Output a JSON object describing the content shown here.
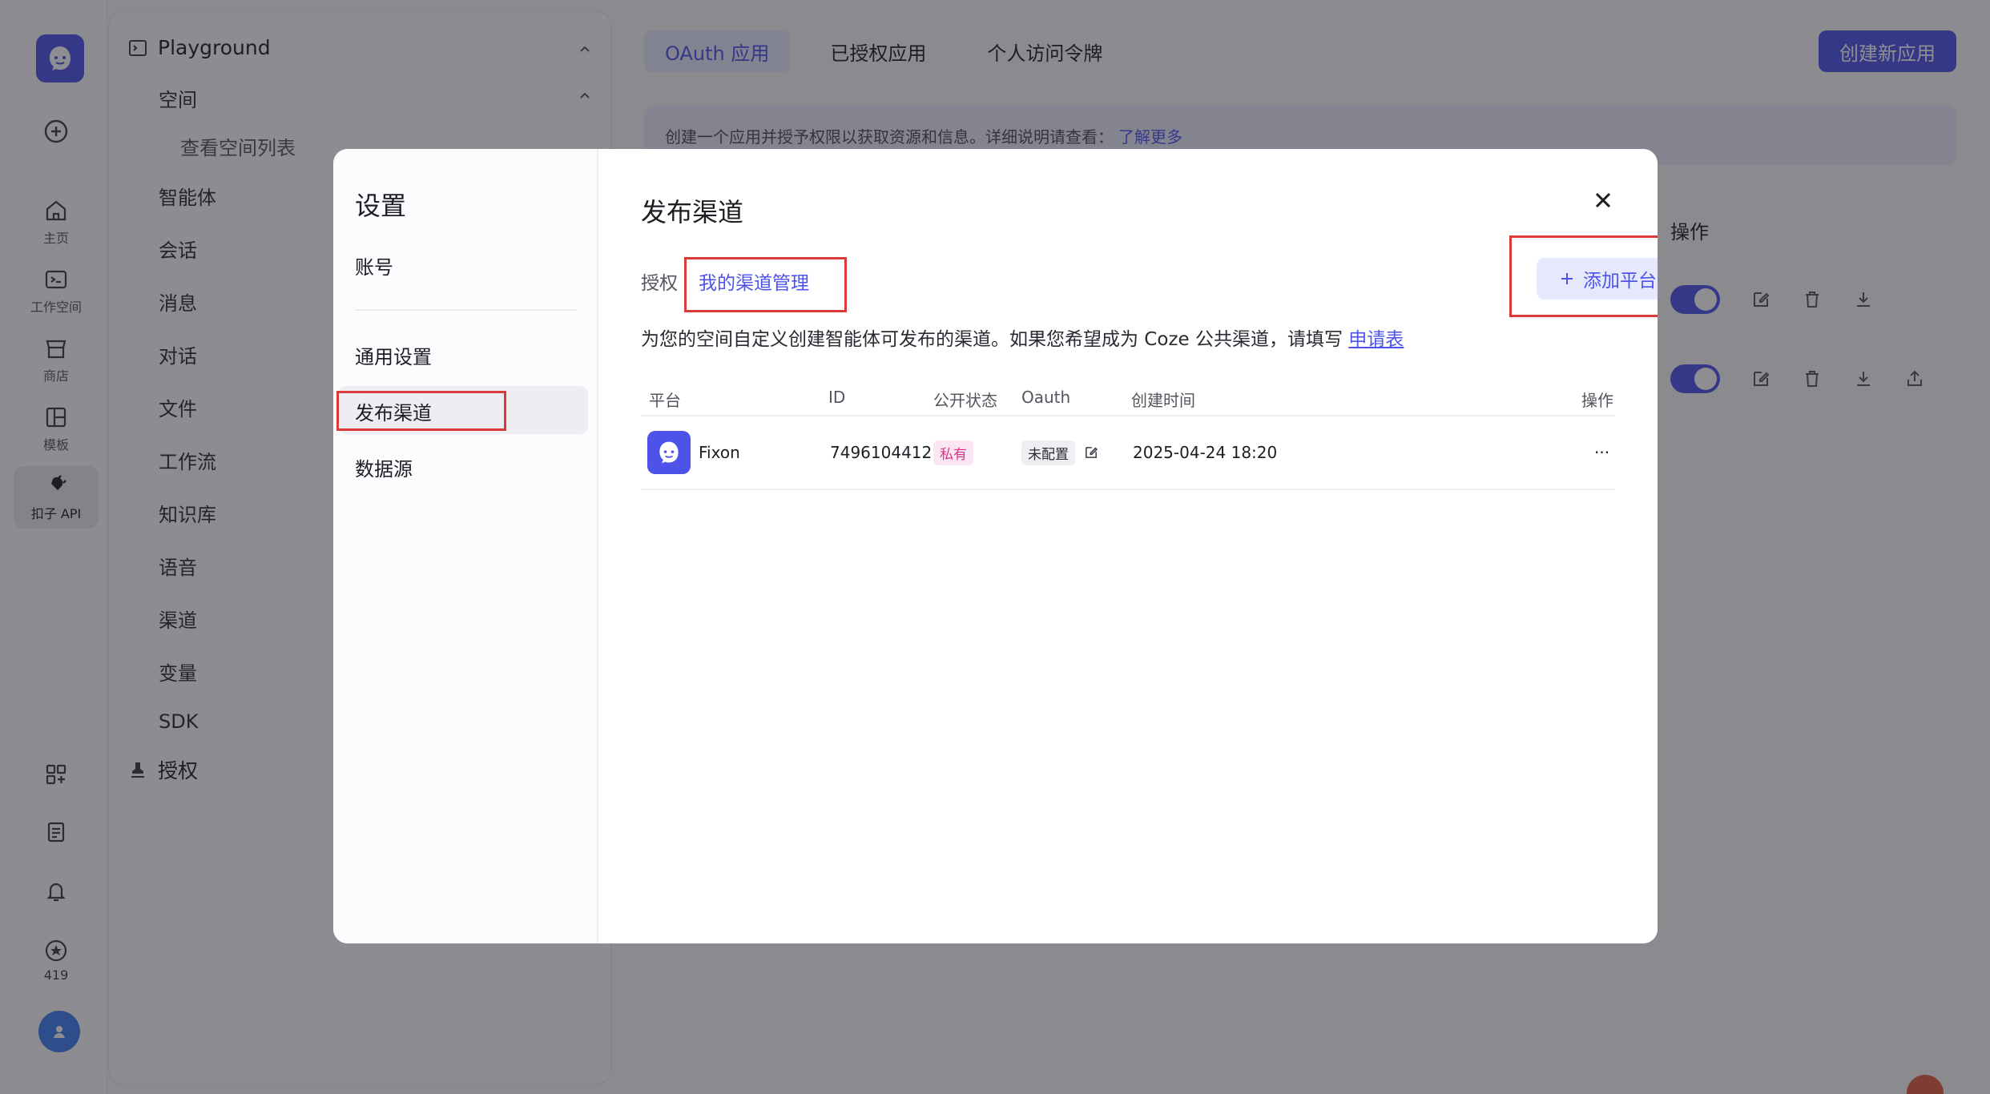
{
  "rail": {
    "items": [
      {
        "icon": "home-icon",
        "label": "主页"
      },
      {
        "icon": "workspace-icon",
        "label": "工作空间"
      },
      {
        "icon": "store-icon",
        "label": "商店"
      },
      {
        "icon": "template-icon",
        "label": "模板"
      },
      {
        "icon": "api-plug-icon",
        "label": "扣子 API"
      }
    ],
    "count_label": "419"
  },
  "nav": {
    "playground": "Playground",
    "space": "空间",
    "space_list": "查看空间列表",
    "items": [
      "智能体",
      "会话",
      "消息",
      "对话",
      "文件",
      "工作流",
      "知识库",
      "语音",
      "渠道",
      "变量",
      "SDK"
    ],
    "auth": "授权"
  },
  "main": {
    "tabs": [
      "OAuth 应用",
      "已授权应用",
      "个人访问令牌"
    ],
    "create_button": "创建新应用",
    "banner_text": "创建一个应用并授予权限以获取资源和信息。详细说明请查看：",
    "banner_link": "了解更多",
    "ops_header": "操作"
  },
  "modal": {
    "title": "设置",
    "nav": {
      "account": "账号",
      "general": "通用设置",
      "publish": "发布渠道",
      "datasource": "数据源"
    },
    "panel_title": "发布渠道",
    "subtabs": {
      "auth": "授权",
      "manage": "我的渠道管理"
    },
    "add_button": "添加平台",
    "description": "为您的空间自定义创建智能体可发布的渠道。如果您希望成为 Coze 公共渠道，请填写",
    "description_link": "申请表",
    "table": {
      "headers": {
        "platform": "平台",
        "id": "ID",
        "status": "公开状态",
        "oauth": "Oauth",
        "created": "创建时间",
        "ops": "操作"
      },
      "rows": [
        {
          "name": "Fixon",
          "id": "7496104412···",
          "status": "私有",
          "oauth": "未配置",
          "created": "2025-04-24 18:20",
          "more": "···"
        }
      ]
    }
  }
}
